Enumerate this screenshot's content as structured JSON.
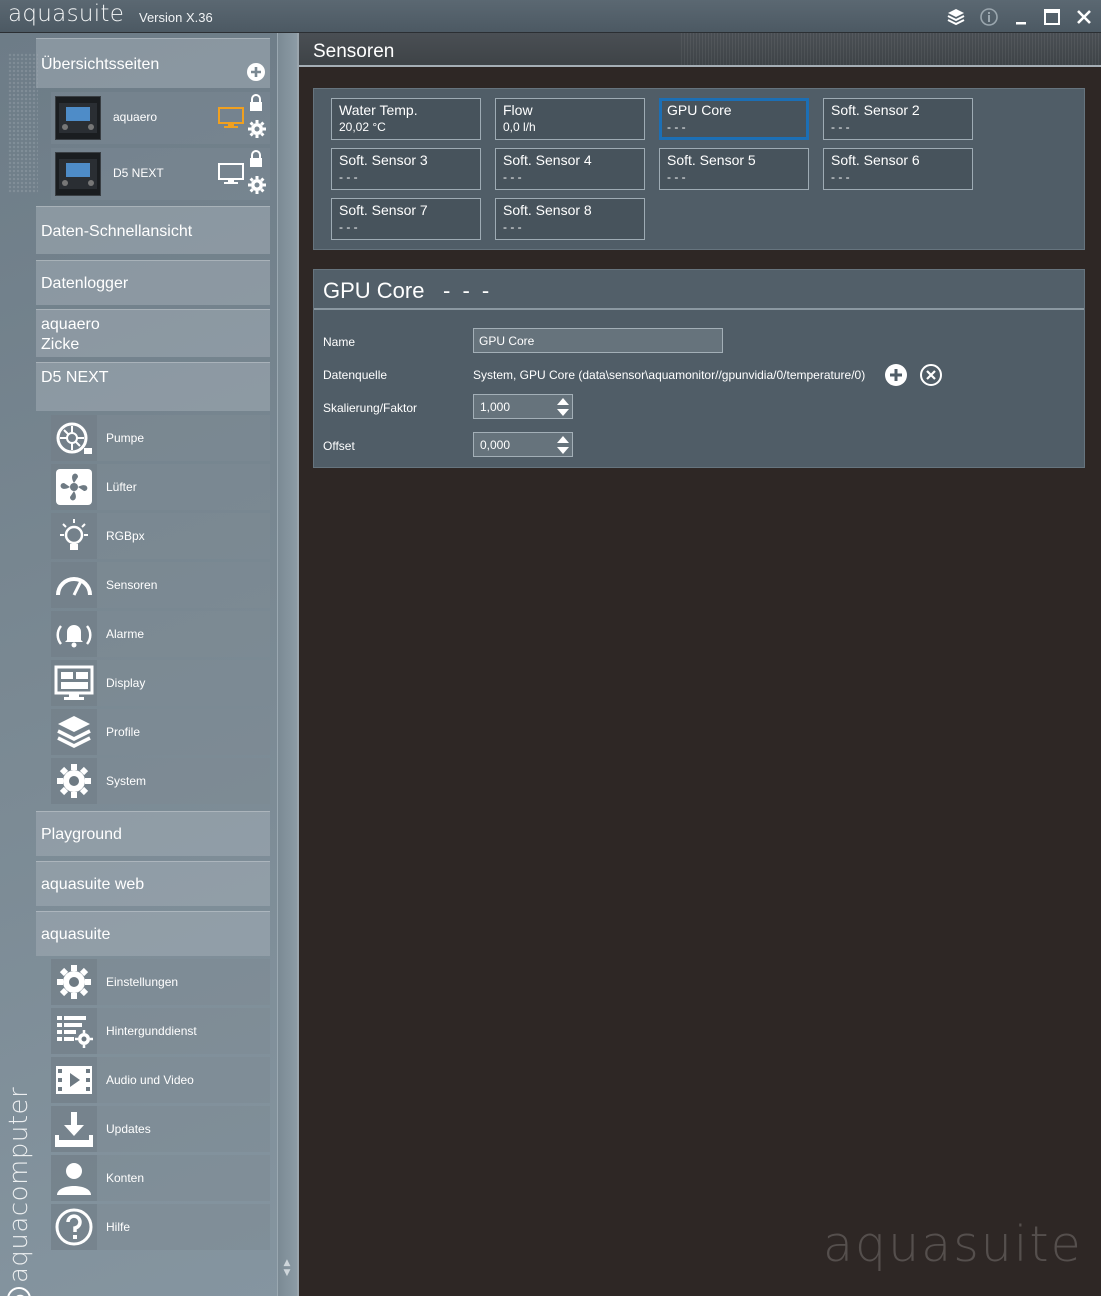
{
  "app": {
    "title": "aquasuite",
    "version": "Version X.36"
  },
  "titlebar": {
    "icons": [
      "layers-icon",
      "info-icon",
      "minimize-icon",
      "maximize-icon",
      "close-icon"
    ]
  },
  "sidebar": {
    "overview_label": "Übersichtsseiten",
    "devices": [
      {
        "name": "aquaero",
        "monitor_color": "#f0a020"
      },
      {
        "name": "D5 NEXT",
        "monitor_color": "#ffffff"
      }
    ],
    "quick_view_label": "Daten-Schnellansicht",
    "datalogger_label": "Datenlogger",
    "aquaero_zicke_line1": "aquaero",
    "aquaero_zicke_line2": "Zicke",
    "d5next_label": "D5 NEXT",
    "d5_items": [
      {
        "label": "Pumpe",
        "icon": "pump-icon"
      },
      {
        "label": "Lüfter",
        "icon": "fan-icon"
      },
      {
        "label": "RGBpx",
        "icon": "bulb-icon"
      },
      {
        "label": "Sensoren",
        "icon": "gauge-icon"
      },
      {
        "label": "Alarme",
        "icon": "alarm-icon"
      },
      {
        "label": "Display",
        "icon": "display-icon"
      },
      {
        "label": "Profile",
        "icon": "layers-icon"
      },
      {
        "label": "System",
        "icon": "gear-icon"
      }
    ],
    "playground_label": "Playground",
    "web_label": "aquasuite web",
    "aquasuite_label": "aquasuite",
    "aquasuite_items": [
      {
        "label": "Einstellungen",
        "icon": "gear-icon"
      },
      {
        "label": "Hintergunddienst",
        "icon": "service-icon"
      },
      {
        "label": "Audio und Video",
        "icon": "film-icon"
      },
      {
        "label": "Updates",
        "icon": "download-icon"
      },
      {
        "label": "Konten",
        "icon": "user-icon"
      },
      {
        "label": "Hilfe",
        "icon": "help-icon"
      }
    ],
    "brand": "aquacomputer"
  },
  "main": {
    "title": "Sensoren",
    "sensors": [
      {
        "name": "Water Temp.",
        "value": "20,02 °C"
      },
      {
        "name": "Flow",
        "value": "0,0 l/h"
      },
      {
        "name": "GPU Core",
        "value": "- - -",
        "selected": true
      },
      {
        "name": "Soft. Sensor 2",
        "value": "- - -"
      },
      {
        "name": "Soft. Sensor 3",
        "value": "- - -"
      },
      {
        "name": "Soft. Sensor 4",
        "value": "- - -"
      },
      {
        "name": "Soft. Sensor 5",
        "value": "- - -"
      },
      {
        "name": "Soft. Sensor 6",
        "value": "- - -"
      },
      {
        "name": "Soft. Sensor 7",
        "value": "- - -"
      },
      {
        "name": "Soft. Sensor 8",
        "value": "- - -"
      }
    ],
    "detail": {
      "title": "GPU Core",
      "value": "- - -",
      "name_label": "Name",
      "name_value": "GPU Core",
      "source_label": "Datenquelle",
      "source_value": "System, GPU Core (data\\sensor\\aquamonitor//gpunvidia/0/temperature/0)",
      "scale_label": "Skalierung/Faktor",
      "scale_value": "1,000",
      "offset_label": "Offset",
      "offset_value": "0,000"
    },
    "watermark": "aquasuite"
  },
  "colors": {
    "selection_border": "#1c6fb5",
    "main_background": "#2e2725",
    "panel": "#505d67"
  }
}
